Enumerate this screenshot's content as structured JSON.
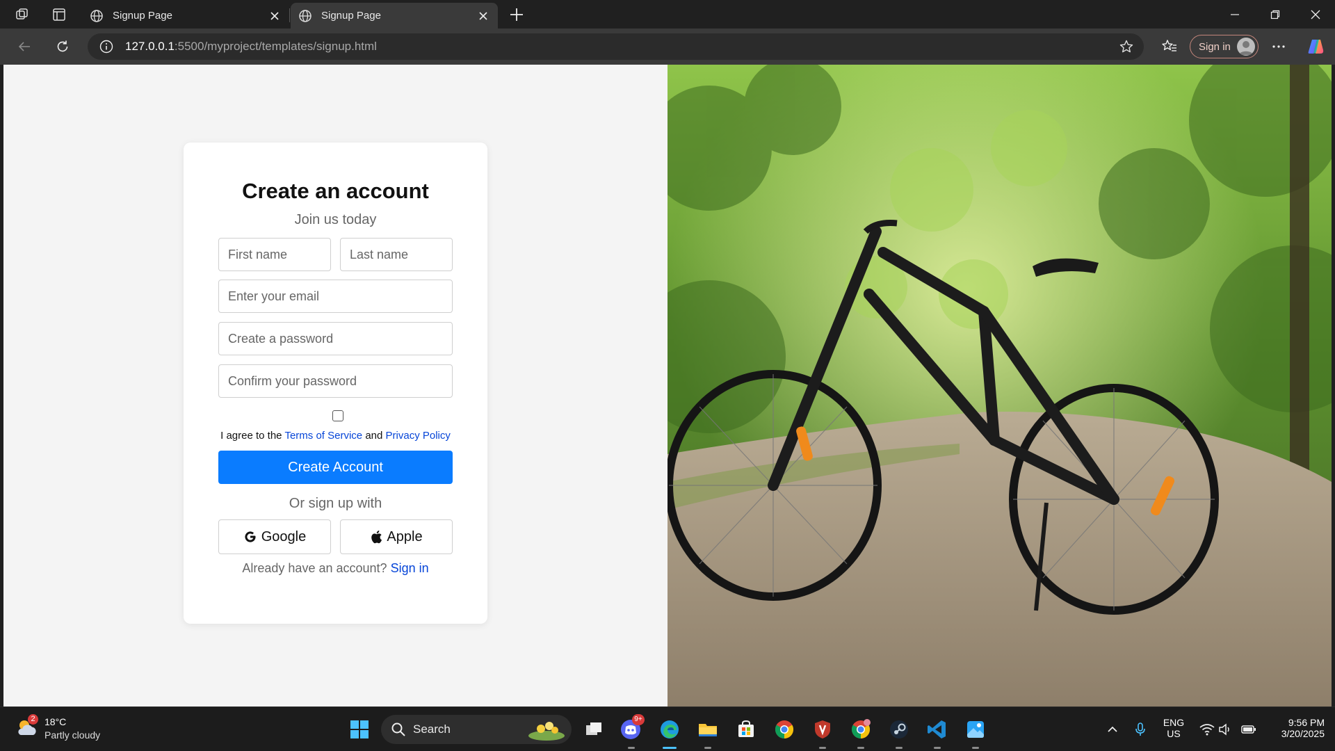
{
  "browser": {
    "tabs": [
      {
        "title": "Signup Page",
        "active": false
      },
      {
        "title": "Signup Page",
        "active": true
      }
    ],
    "url_host": "127.0.0.1",
    "url_rest": ":5500/myproject/templates/signup.html",
    "profile_label": "Sign in"
  },
  "signup": {
    "title": "Create an account",
    "subtitle": "Join us today",
    "first_name_placeholder": "First name",
    "last_name_placeholder": "Last name",
    "email_placeholder": "Enter your email",
    "password_placeholder": "Create a password",
    "confirm_placeholder": "Confirm your password",
    "agree_prefix": "I agree to the",
    "terms_link": "Terms of Service",
    "agree_and": "and",
    "privacy_link": "Privacy Policy",
    "submit_label": "Create Account",
    "or_text": "Or sign up with",
    "google_label": "Google",
    "apple_label": "Apple",
    "have_account": "Already have an account?",
    "signin_link": "Sign in"
  },
  "taskbar": {
    "weather_badge": "2",
    "weather_temp": "18°C",
    "weather_condition": "Partly cloudy",
    "search_label": "Search",
    "discord_badge": "9+",
    "lang_line1": "ENG",
    "lang_line2": "US",
    "time": "9:56 PM",
    "date": "3/20/2025"
  },
  "colors": {
    "primary_button": "#0a7cff",
    "link": "#0645d8",
    "card_bg": "#ffffff",
    "page_bg": "#f4f4f4"
  }
}
